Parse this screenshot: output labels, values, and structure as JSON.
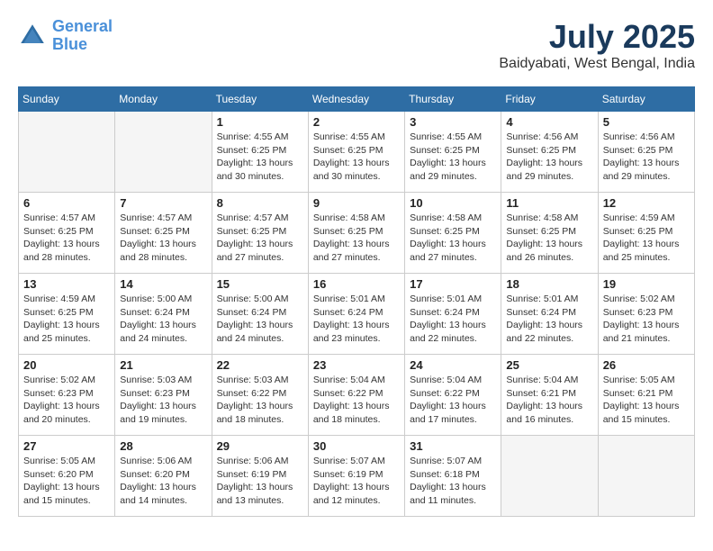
{
  "header": {
    "logo_line1": "General",
    "logo_line2": "Blue",
    "month_year": "July 2025",
    "location": "Baidyabati, West Bengal, India"
  },
  "days_of_week": [
    "Sunday",
    "Monday",
    "Tuesday",
    "Wednesday",
    "Thursday",
    "Friday",
    "Saturday"
  ],
  "weeks": [
    [
      {
        "day": "",
        "info": ""
      },
      {
        "day": "",
        "info": ""
      },
      {
        "day": "1",
        "info": "Sunrise: 4:55 AM\nSunset: 6:25 PM\nDaylight: 13 hours and 30 minutes."
      },
      {
        "day": "2",
        "info": "Sunrise: 4:55 AM\nSunset: 6:25 PM\nDaylight: 13 hours and 30 minutes."
      },
      {
        "day": "3",
        "info": "Sunrise: 4:55 AM\nSunset: 6:25 PM\nDaylight: 13 hours and 29 minutes."
      },
      {
        "day": "4",
        "info": "Sunrise: 4:56 AM\nSunset: 6:25 PM\nDaylight: 13 hours and 29 minutes."
      },
      {
        "day": "5",
        "info": "Sunrise: 4:56 AM\nSunset: 6:25 PM\nDaylight: 13 hours and 29 minutes."
      }
    ],
    [
      {
        "day": "6",
        "info": "Sunrise: 4:57 AM\nSunset: 6:25 PM\nDaylight: 13 hours and 28 minutes."
      },
      {
        "day": "7",
        "info": "Sunrise: 4:57 AM\nSunset: 6:25 PM\nDaylight: 13 hours and 28 minutes."
      },
      {
        "day": "8",
        "info": "Sunrise: 4:57 AM\nSunset: 6:25 PM\nDaylight: 13 hours and 27 minutes."
      },
      {
        "day": "9",
        "info": "Sunrise: 4:58 AM\nSunset: 6:25 PM\nDaylight: 13 hours and 27 minutes."
      },
      {
        "day": "10",
        "info": "Sunrise: 4:58 AM\nSunset: 6:25 PM\nDaylight: 13 hours and 27 minutes."
      },
      {
        "day": "11",
        "info": "Sunrise: 4:58 AM\nSunset: 6:25 PM\nDaylight: 13 hours and 26 minutes."
      },
      {
        "day": "12",
        "info": "Sunrise: 4:59 AM\nSunset: 6:25 PM\nDaylight: 13 hours and 25 minutes."
      }
    ],
    [
      {
        "day": "13",
        "info": "Sunrise: 4:59 AM\nSunset: 6:25 PM\nDaylight: 13 hours and 25 minutes."
      },
      {
        "day": "14",
        "info": "Sunrise: 5:00 AM\nSunset: 6:24 PM\nDaylight: 13 hours and 24 minutes."
      },
      {
        "day": "15",
        "info": "Sunrise: 5:00 AM\nSunset: 6:24 PM\nDaylight: 13 hours and 24 minutes."
      },
      {
        "day": "16",
        "info": "Sunrise: 5:01 AM\nSunset: 6:24 PM\nDaylight: 13 hours and 23 minutes."
      },
      {
        "day": "17",
        "info": "Sunrise: 5:01 AM\nSunset: 6:24 PM\nDaylight: 13 hours and 22 minutes."
      },
      {
        "day": "18",
        "info": "Sunrise: 5:01 AM\nSunset: 6:24 PM\nDaylight: 13 hours and 22 minutes."
      },
      {
        "day": "19",
        "info": "Sunrise: 5:02 AM\nSunset: 6:23 PM\nDaylight: 13 hours and 21 minutes."
      }
    ],
    [
      {
        "day": "20",
        "info": "Sunrise: 5:02 AM\nSunset: 6:23 PM\nDaylight: 13 hours and 20 minutes."
      },
      {
        "day": "21",
        "info": "Sunrise: 5:03 AM\nSunset: 6:23 PM\nDaylight: 13 hours and 19 minutes."
      },
      {
        "day": "22",
        "info": "Sunrise: 5:03 AM\nSunset: 6:22 PM\nDaylight: 13 hours and 18 minutes."
      },
      {
        "day": "23",
        "info": "Sunrise: 5:04 AM\nSunset: 6:22 PM\nDaylight: 13 hours and 18 minutes."
      },
      {
        "day": "24",
        "info": "Sunrise: 5:04 AM\nSunset: 6:22 PM\nDaylight: 13 hours and 17 minutes."
      },
      {
        "day": "25",
        "info": "Sunrise: 5:04 AM\nSunset: 6:21 PM\nDaylight: 13 hours and 16 minutes."
      },
      {
        "day": "26",
        "info": "Sunrise: 5:05 AM\nSunset: 6:21 PM\nDaylight: 13 hours and 15 minutes."
      }
    ],
    [
      {
        "day": "27",
        "info": "Sunrise: 5:05 AM\nSunset: 6:20 PM\nDaylight: 13 hours and 15 minutes."
      },
      {
        "day": "28",
        "info": "Sunrise: 5:06 AM\nSunset: 6:20 PM\nDaylight: 13 hours and 14 minutes."
      },
      {
        "day": "29",
        "info": "Sunrise: 5:06 AM\nSunset: 6:19 PM\nDaylight: 13 hours and 13 minutes."
      },
      {
        "day": "30",
        "info": "Sunrise: 5:07 AM\nSunset: 6:19 PM\nDaylight: 13 hours and 12 minutes."
      },
      {
        "day": "31",
        "info": "Sunrise: 5:07 AM\nSunset: 6:18 PM\nDaylight: 13 hours and 11 minutes."
      },
      {
        "day": "",
        "info": ""
      },
      {
        "day": "",
        "info": ""
      }
    ]
  ]
}
